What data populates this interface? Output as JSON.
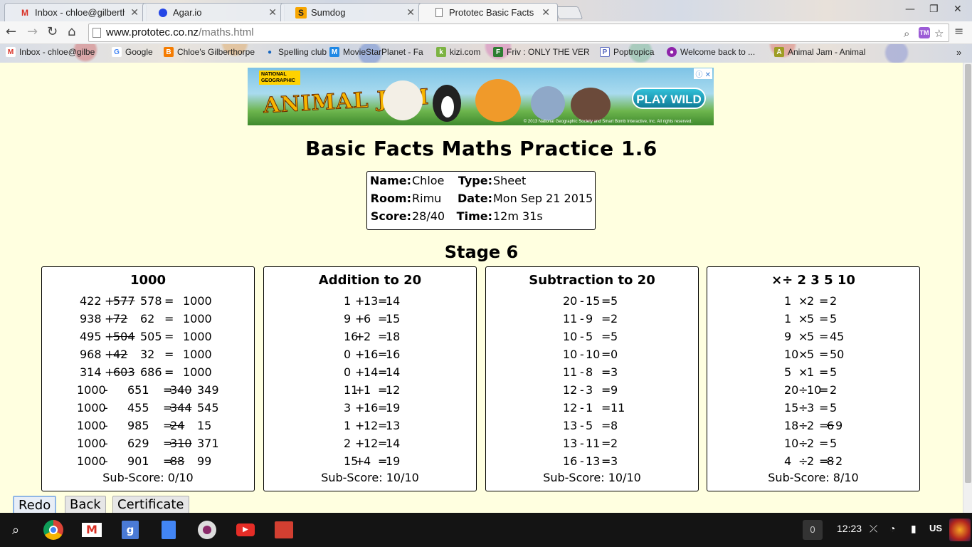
{
  "browser": {
    "tabs": [
      {
        "title": "Inbox - chloe@gilberthor",
        "favicon": "gmail-icon",
        "active": false
      },
      {
        "title": "Agar.io",
        "favicon": "agario-icon",
        "active": false
      },
      {
        "title": "Sumdog",
        "favicon": "sumdog-icon",
        "active": false
      },
      {
        "title": "Prototec Basic Facts Ma",
        "favicon": "page-icon",
        "active": true
      }
    ],
    "url_host": "www.prototec.co.nz",
    "url_path": "/maths.html",
    "bookmarks": [
      {
        "label": "Inbox - chloe@gilbe",
        "icon": "gmail-icon",
        "color": "#d93025"
      },
      {
        "label": "Google",
        "icon": "google-icon",
        "color": "#4285f4"
      },
      {
        "label": "Chloe's Gilberthorpe",
        "icon": "blogger-icon",
        "color": "#f57c00"
      },
      {
        "label": "Spelling club",
        "icon": "dot-icon",
        "color": "#1565c0"
      },
      {
        "label": "MovieStarPlanet - Fa",
        "icon": "msp-icon",
        "color": "#1e88e5"
      },
      {
        "label": "kizi.com",
        "icon": "kizi-icon",
        "color": "#7cb342"
      },
      {
        "label": "Friv : ONLY THE VER",
        "icon": "friv-icon",
        "color": "#2e7d32"
      },
      {
        "label": "Poptropica",
        "icon": "poptropica-icon",
        "color": "#5c6bc0"
      },
      {
        "label": "Welcome back to ...",
        "icon": "msp-icon",
        "color": "#8e24aa"
      },
      {
        "label": "Animal Jam - Animal",
        "icon": "animaljam-icon",
        "color": "#9e9d24"
      }
    ]
  },
  "ad": {
    "badge": "NATIONAL GEOGRAPHIC",
    "brand": "ANIMAL JAM",
    "cta": "PLAY WILD",
    "copyright": "© 2013 National Geographic Society and Smart Bomb Interactive, Inc. All rights reserved."
  },
  "page": {
    "title": "Basic Facts Maths Practice 1.6",
    "info": {
      "name_label": "Name:",
      "name": "Chloe",
      "type_label": "Type:",
      "type": "Sheet",
      "room_label": "Room:",
      "room": "Rimu",
      "date_label": "Date:",
      "date": "Mon Sep 21 2015",
      "score_label": "Score:",
      "score": "28/40",
      "time_label": "Time:",
      "time": "12m 31s"
    },
    "stage": "Stage 6",
    "panels": [
      {
        "heading": "1000",
        "rows": [
          {
            "a": "422",
            "op": "+",
            "wrong": "577",
            "ans": "578",
            "eq": "=",
            "res": "1000"
          },
          {
            "a": "938",
            "op": "+",
            "wrong": "72",
            "ans": "62",
            "eq": "=",
            "res": "1000"
          },
          {
            "a": "495",
            "op": "+",
            "wrong": "504",
            "ans": "505",
            "eq": "=",
            "res": "1000"
          },
          {
            "a": "968",
            "op": "+",
            "wrong": "42",
            "ans": "32",
            "eq": "=",
            "res": "1000"
          },
          {
            "a": "314",
            "op": "+",
            "wrong": "603",
            "ans": "686",
            "eq": "=",
            "res": "1000"
          },
          {
            "a": "1000",
            "op": "-",
            "b": "651",
            "eq": "=",
            "wrong": "340",
            "ans": "349"
          },
          {
            "a": "1000",
            "op": "-",
            "b": "455",
            "eq": "=",
            "wrong": "344",
            "ans": "545"
          },
          {
            "a": "1000",
            "op": "-",
            "b": "985",
            "eq": "=",
            "wrong": "24",
            "ans": "15"
          },
          {
            "a": "1000",
            "op": "-",
            "b": "629",
            "eq": "=",
            "wrong": "310",
            "ans": "371"
          },
          {
            "a": "1000",
            "op": "-",
            "b": "901",
            "eq": "=",
            "wrong": "88",
            "ans": "99"
          }
        ],
        "sub_score": "Sub-Score: 0/10"
      },
      {
        "heading": "Addition to 20",
        "rows": [
          {
            "a": "1",
            "op": "+",
            "b": "13",
            "eq": "=",
            "ans": "14"
          },
          {
            "a": "9",
            "op": "+",
            "b": "6",
            "eq": "=",
            "ans": "15"
          },
          {
            "a": "16",
            "op": "+",
            "b": "2",
            "eq": "=",
            "ans": "18"
          },
          {
            "a": "0",
            "op": "+",
            "b": "16",
            "eq": "=",
            "ans": "16"
          },
          {
            "a": "0",
            "op": "+",
            "b": "14",
            "eq": "=",
            "ans": "14"
          },
          {
            "a": "11",
            "op": "+",
            "b": "1",
            "eq": "=",
            "ans": "12"
          },
          {
            "a": "3",
            "op": "+",
            "b": "16",
            "eq": "=",
            "ans": "19"
          },
          {
            "a": "1",
            "op": "+",
            "b": "12",
            "eq": "=",
            "ans": "13"
          },
          {
            "a": "2",
            "op": "+",
            "b": "12",
            "eq": "=",
            "ans": "14"
          },
          {
            "a": "15",
            "op": "+",
            "b": "4",
            "eq": "=",
            "ans": "19"
          }
        ],
        "sub_score": "Sub-Score: 10/10"
      },
      {
        "heading": "Subtraction to 20",
        "rows": [
          {
            "a": "20",
            "op": "-",
            "b": "15",
            "eq": "=",
            "ans": "5"
          },
          {
            "a": "11",
            "op": "-",
            "b": "9",
            "eq": "=",
            "ans": "2"
          },
          {
            "a": "10",
            "op": "-",
            "b": "5",
            "eq": "=",
            "ans": "5"
          },
          {
            "a": "10",
            "op": "-",
            "b": "10",
            "eq": "=",
            "ans": "0"
          },
          {
            "a": "11",
            "op": "-",
            "b": "8",
            "eq": "=",
            "ans": "3"
          },
          {
            "a": "12",
            "op": "-",
            "b": "3",
            "eq": "=",
            "ans": "9"
          },
          {
            "a": "12",
            "op": "-",
            "b": "1",
            "eq": "=",
            "ans": "11"
          },
          {
            "a": "13",
            "op": "-",
            "b": "5",
            "eq": "=",
            "ans": "8"
          },
          {
            "a": "13",
            "op": "-",
            "b": "11",
            "eq": "=",
            "ans": "2"
          },
          {
            "a": "16",
            "op": "-",
            "b": "13",
            "eq": "=",
            "ans": "3"
          }
        ],
        "sub_score": "Sub-Score: 10/10"
      },
      {
        "heading": "×÷ 2 3 5 10",
        "rows": [
          {
            "a": "1",
            "op": "×",
            "b": "2",
            "eq": "=",
            "ans": "2"
          },
          {
            "a": "1",
            "op": "×",
            "b": "5",
            "eq": "=",
            "ans": "5"
          },
          {
            "a": "9",
            "op": "×",
            "b": "5",
            "eq": "=",
            "ans": "45"
          },
          {
            "a": "10",
            "op": "×",
            "b": "5",
            "eq": "=",
            "ans": "50"
          },
          {
            "a": "5",
            "op": "×",
            "b": "1",
            "eq": "=",
            "ans": "5"
          },
          {
            "a": "20",
            "op": "÷",
            "b": "10",
            "eq": "=",
            "ans": "2"
          },
          {
            "a": "15",
            "op": "÷",
            "b": "3",
            "eq": "=",
            "ans": "5"
          },
          {
            "a": "18",
            "op": "÷",
            "b": "2",
            "eq": "=",
            "wrong": "6",
            "ans": "9"
          },
          {
            "a": "10",
            "op": "÷",
            "b": "2",
            "eq": "=",
            "ans": "5"
          },
          {
            "a": "4",
            "op": "÷",
            "b": "2",
            "eq": "=",
            "wrong": "8",
            "ans": "2"
          }
        ],
        "sub_score": "Sub-Score: 8/10"
      }
    ],
    "buttons": {
      "redo": "Redo",
      "back": "Back",
      "certificate": "Certificate"
    }
  },
  "taskbar": {
    "apps": [
      "search-icon",
      "chrome-icon",
      "gmail-icon",
      "google-plus-icon",
      "docs-icon",
      "camera-icon",
      "youtube-icon",
      "photos-icon"
    ],
    "notifications": "0",
    "time": "12:23",
    "locale": "US"
  }
}
